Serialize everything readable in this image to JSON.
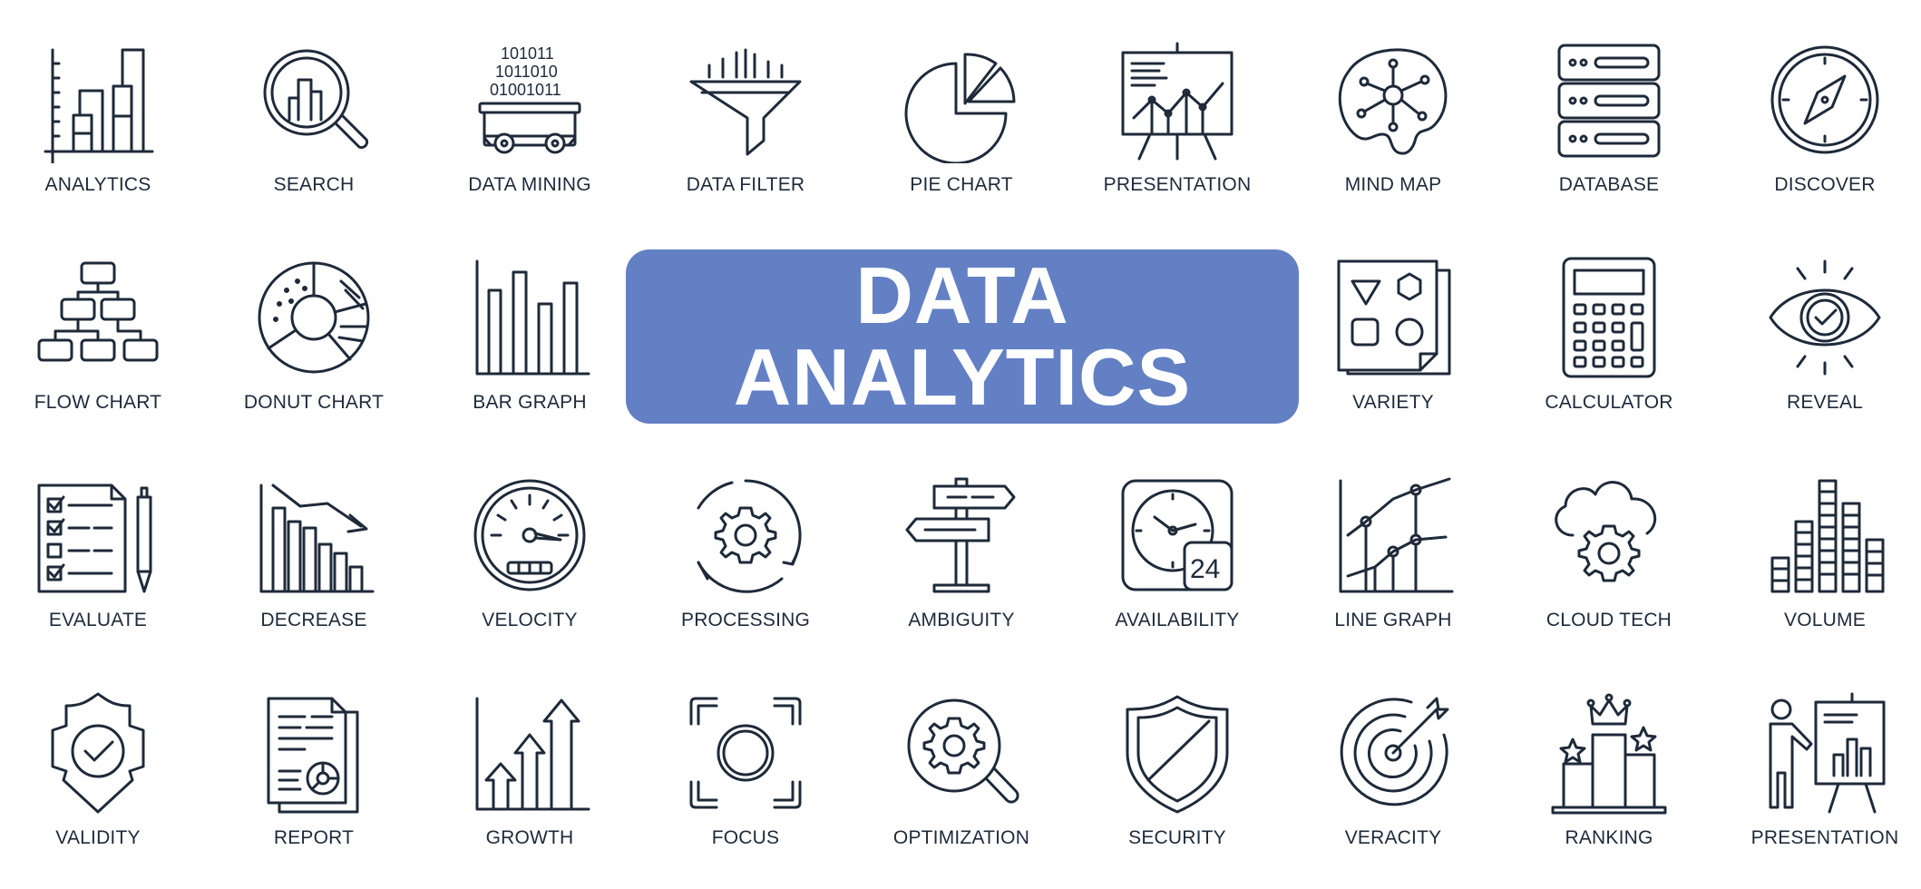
{
  "banner": {
    "line1": "DATA",
    "line2": "ANALYTICS",
    "background_color": "#6380c4",
    "text_color": "#ffffff"
  },
  "icon_color": "#1e2a3a",
  "icons": [
    {
      "label": "ANALYTICS",
      "icon": "bar-chart-icon"
    },
    {
      "label": "SEARCH",
      "icon": "magnifier-chart-icon"
    },
    {
      "label": "DATA MINING",
      "icon": "mine-cart-binary-icon",
      "binary_rows": [
        "101011",
        "1011010",
        "01001011"
      ]
    },
    {
      "label": "DATA FILTER",
      "icon": "funnel-icon"
    },
    {
      "label": "PIE CHART",
      "icon": "pie-chart-icon"
    },
    {
      "label": "PRESENTATION",
      "icon": "presentation-board-icon"
    },
    {
      "label": "MIND MAP",
      "icon": "brain-network-icon"
    },
    {
      "label": "DATABASE",
      "icon": "server-stack-icon"
    },
    {
      "label": "DISCOVER",
      "icon": "compass-icon"
    },
    {
      "label": "FLOW CHART",
      "icon": "flow-chart-icon"
    },
    {
      "label": "DONUT CHART",
      "icon": "donut-chart-icon"
    },
    {
      "label": "BAR GRAPH",
      "icon": "bar-graph-icon"
    },
    {
      "label": "VARIETY",
      "icon": "shapes-icon"
    },
    {
      "label": "CALCULATOR",
      "icon": "calculator-icon"
    },
    {
      "label": "REVEAL",
      "icon": "eye-check-icon"
    },
    {
      "label": "EVALUATE",
      "icon": "checklist-pen-icon"
    },
    {
      "label": "DECREASE",
      "icon": "decreasing-chart-icon"
    },
    {
      "label": "VELOCITY",
      "icon": "speedometer-icon"
    },
    {
      "label": "PROCESSING",
      "icon": "gear-cycle-icon"
    },
    {
      "label": "AMBIGUITY",
      "icon": "signpost-icon"
    },
    {
      "label": "AVAILABILITY",
      "icon": "clock-24-icon",
      "badge": "24"
    },
    {
      "label": "LINE GRAPH",
      "icon": "line-graph-icon"
    },
    {
      "label": "CLOUD TECH",
      "icon": "cloud-gear-icon"
    },
    {
      "label": "VOLUME",
      "icon": "volume-bars-icon"
    },
    {
      "label": "VALIDITY",
      "icon": "shield-check-ribbon-icon"
    },
    {
      "label": "REPORT",
      "icon": "report-document-icon"
    },
    {
      "label": "GROWTH",
      "icon": "growth-arrows-icon"
    },
    {
      "label": "FOCUS",
      "icon": "focus-frame-icon"
    },
    {
      "label": "OPTIMIZATION",
      "icon": "magnifier-gear-icon"
    },
    {
      "label": "SECURITY",
      "icon": "shield-icon"
    },
    {
      "label": "VERACITY",
      "icon": "target-arrow-icon"
    },
    {
      "label": "RANKING",
      "icon": "podium-crown-icon"
    },
    {
      "label": "PRESENTATION",
      "icon": "presenter-board-icon"
    }
  ]
}
